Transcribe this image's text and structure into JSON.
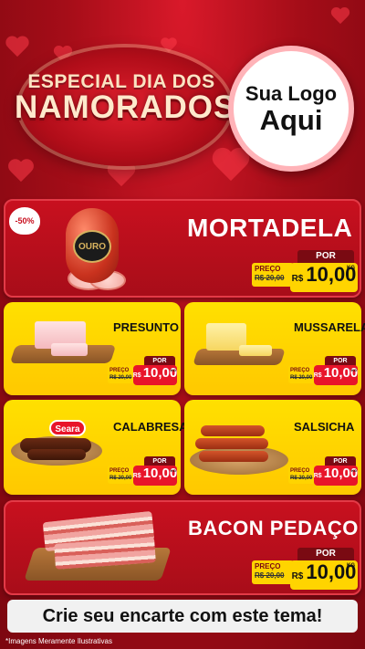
{
  "header": {
    "title_top": "ESPECIAL DIA DOS",
    "title_main": "NAMORADOS",
    "logo_line1": "Sua Logo",
    "logo_line2": "Aqui"
  },
  "products": {
    "mortadela": {
      "name": "MORTADELA",
      "discount": "-50%",
      "brand_label": "OURO",
      "por": "POR",
      "preco_label": "PREÇO",
      "old_price": "R$ 20,00",
      "currency": "R$",
      "price": "10,00",
      "unit": "KG"
    },
    "presunto": {
      "name": "PRESUNTO",
      "por": "POR",
      "preco_label": "PREÇO",
      "old_price": "R$ 20,00",
      "currency": "R$",
      "price": "10,00",
      "unit": "KG"
    },
    "mussarela": {
      "name": "MUSSARELA",
      "por": "POR",
      "preco_label": "PREÇO",
      "old_price": "R$ 20,00",
      "currency": "R$",
      "price": "10,00",
      "unit": "KG"
    },
    "calabresa": {
      "name": "CALABRESA",
      "brand_label": "Seara",
      "por": "POR",
      "preco_label": "PREÇO",
      "old_price": "R$ 20,00",
      "currency": "R$",
      "price": "10,00",
      "unit": "KG"
    },
    "salsicha": {
      "name": "SALSICHA",
      "por": "POR",
      "preco_label": "PREÇO",
      "old_price": "R$ 20,00",
      "currency": "R$",
      "price": "10,00",
      "unit": "KG"
    },
    "bacon": {
      "name": "BACON PEDAÇO",
      "por": "POR",
      "preco_label": "PREÇO",
      "old_price": "R$ 20,00",
      "currency": "R$",
      "price": "10,00",
      "unit": "KG"
    }
  },
  "footer": {
    "cta": "Crie seu encarte com este tema!",
    "disclaimer": "*Imagens Meramente Ilustrativas"
  },
  "colors": {
    "background_red": "#a50d18",
    "card_yellow": "#ffd400",
    "price_red": "#e8142a",
    "tag_dark_red": "#7a0a12"
  },
  "icons": [
    "heart-icon",
    "leaf-icon"
  ]
}
